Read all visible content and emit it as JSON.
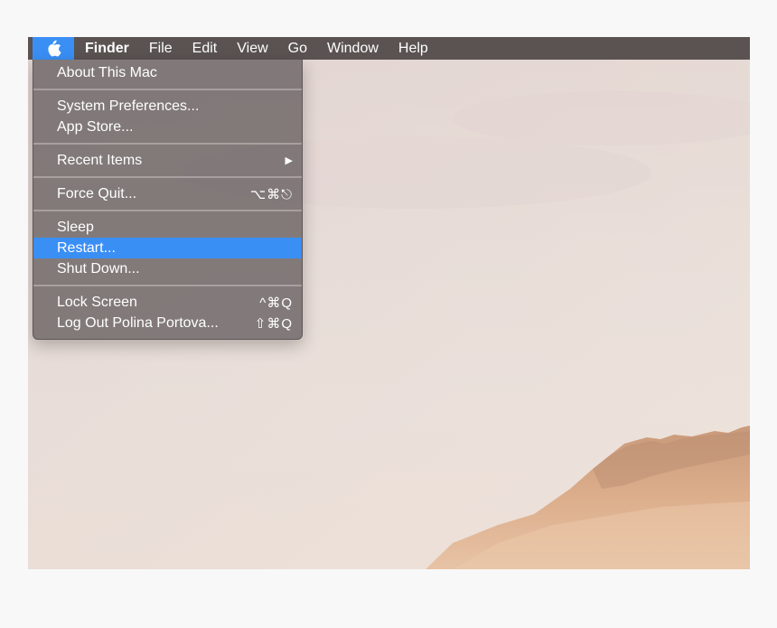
{
  "menubar": {
    "app_name": "Finder",
    "items": [
      "File",
      "Edit",
      "View",
      "Go",
      "Window",
      "Help"
    ]
  },
  "apple_menu": {
    "about": "About This Mac",
    "system_preferences": "System Preferences...",
    "app_store": "App Store...",
    "recent_items": "Recent Items",
    "recent_items_arrow": "▶",
    "force_quit": "Force Quit...",
    "force_quit_shortcut": "⌥⌘⎋",
    "sleep": "Sleep",
    "restart": "Restart...",
    "shut_down": "Shut Down...",
    "lock_screen": "Lock Screen",
    "lock_screen_shortcut": "^⌘Q",
    "log_out": "Log Out Polina Portova...",
    "log_out_shortcut": "⇧⌘Q"
  },
  "colors": {
    "highlight": "#3a8ff5",
    "menubar": "#5a5352",
    "menu_bg": "#7a7272"
  },
  "icons": {
    "apple": "apple-logo-icon"
  }
}
